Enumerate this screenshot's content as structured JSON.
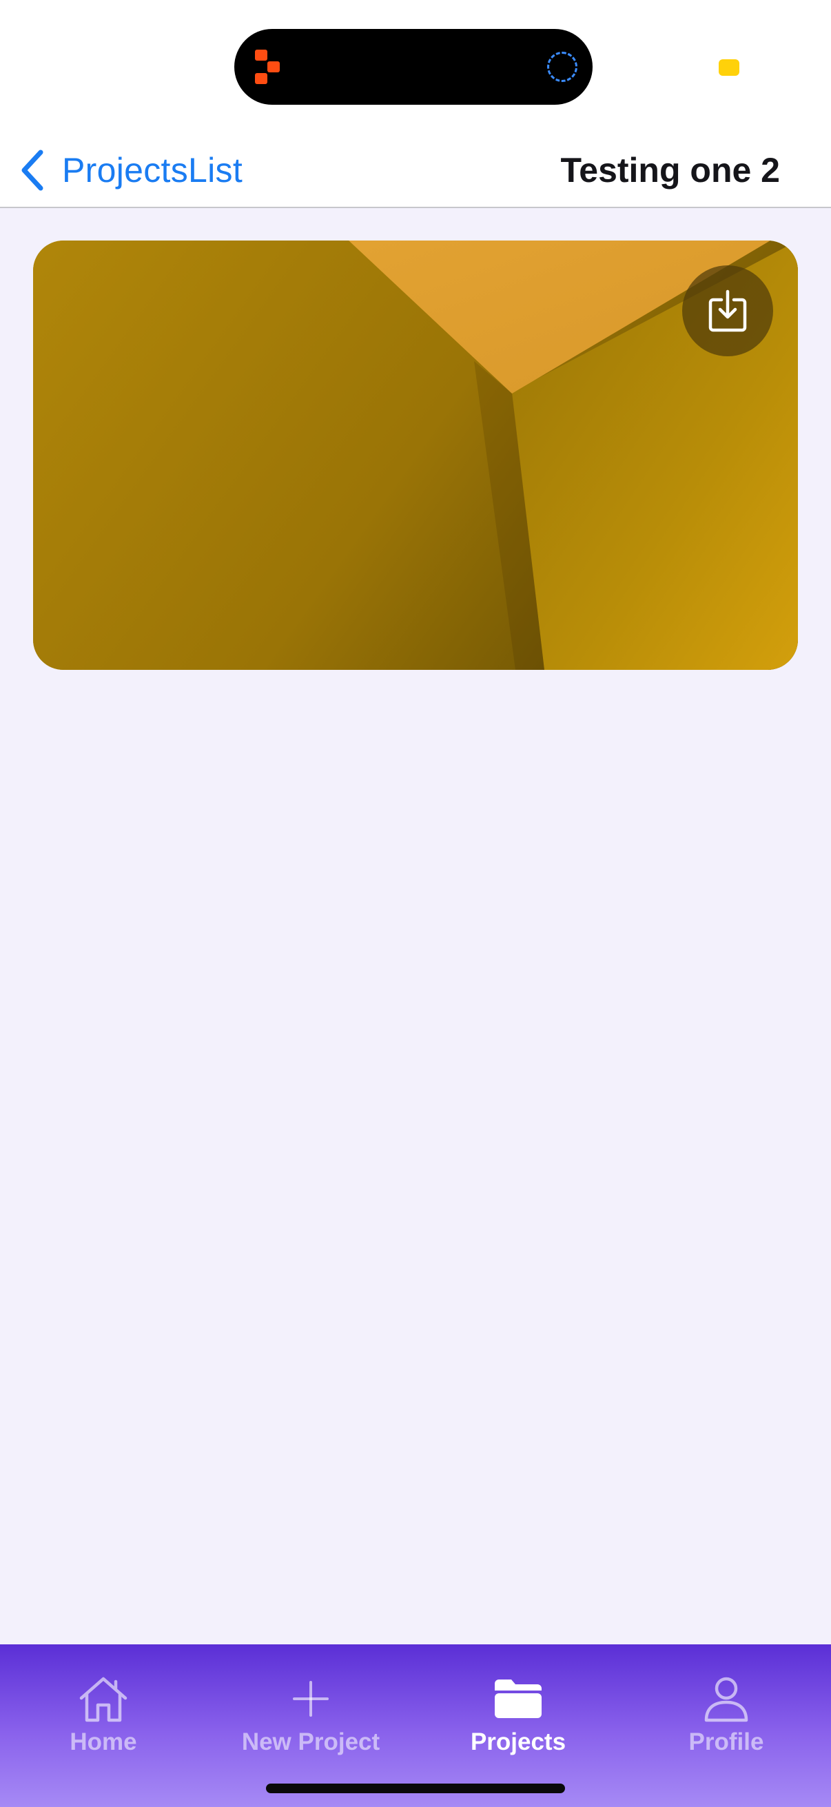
{
  "nav": {
    "back_label": "ProjectsList",
    "title": "Testing one 2"
  },
  "image_card": {
    "icon": "download-icon"
  },
  "tab_bar": {
    "tabs": [
      {
        "label": "Home",
        "icon": "house-icon",
        "active": false
      },
      {
        "label": "New Project",
        "icon": "plus-icon",
        "active": false
      },
      {
        "label": "Projects",
        "icon": "folder-icon",
        "active": true
      },
      {
        "label": "Profile",
        "icon": "person-icon",
        "active": false
      }
    ]
  },
  "colors": {
    "accent": "#1a7cf2",
    "tab_bar_top": "#5b2fd6",
    "tab_bar_bottom": "#a68af5",
    "background": "#f3f1fc"
  }
}
